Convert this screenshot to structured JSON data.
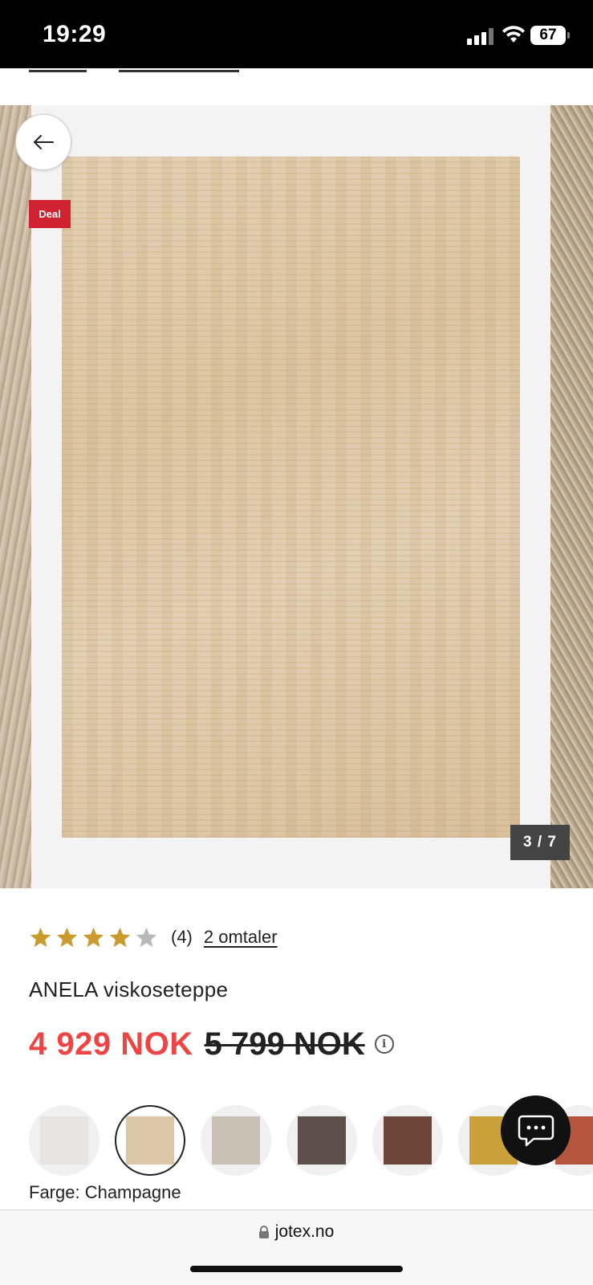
{
  "status_bar": {
    "time": "19:29",
    "battery": "67"
  },
  "gallery": {
    "deal_label": "Deal",
    "counter": "3 / 7",
    "current_image": 3,
    "total_images": 7
  },
  "product": {
    "rating_value": 4,
    "rating_max": 5,
    "rating_count": "(4)",
    "reviews_link": "2 omtaler",
    "title": "ANELA viskoseteppe",
    "price_current": "4 929 NOK",
    "price_original": "5 799 NOK",
    "color_label": "Farge: Champagne"
  },
  "swatches": [
    {
      "color": "#e7e5e2",
      "selected": false
    },
    {
      "color": "#dcc8a8",
      "selected": true
    },
    {
      "color": "#c9c1b4",
      "selected": false
    },
    {
      "color": "#5f4f4a",
      "selected": false
    },
    {
      "color": "#6e4639",
      "selected": false
    },
    {
      "color": "#c9a03a",
      "selected": false
    },
    {
      "color": "#b5553f",
      "selected": false
    }
  ],
  "browser": {
    "url": "jotex.no"
  },
  "colors": {
    "sale_red": "#ef4444",
    "deal_badge": "#cf2331",
    "star_filled": "#c99a2e",
    "star_empty": "#b8b8b8"
  }
}
